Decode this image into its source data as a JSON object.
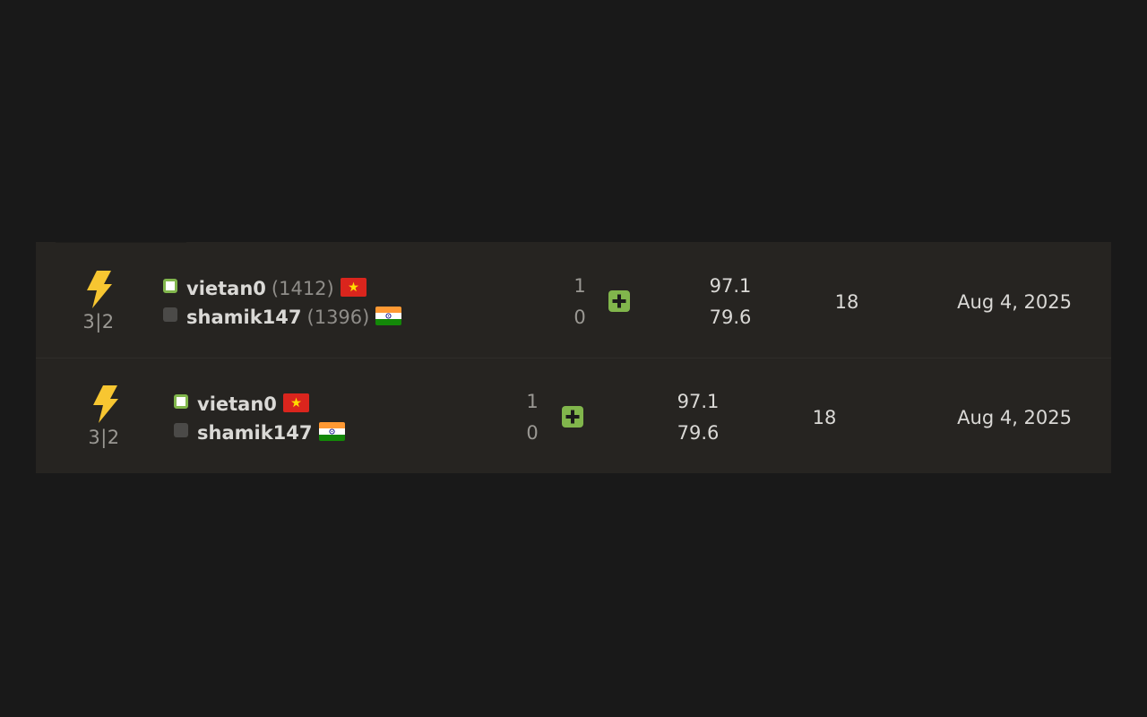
{
  "games": [
    {
      "time_control": "3|2",
      "game_type_icon": "bolt-icon",
      "white": {
        "username": "vietan0",
        "rating": "(1412)",
        "flag": "vietnam-flag-icon"
      },
      "black": {
        "username": "shamik147",
        "rating": "(1396)",
        "flag": "india-flag-icon"
      },
      "result_white": "1",
      "result_black": "0",
      "result_icon": "plus-icon",
      "accuracy_white": "97.1",
      "accuracy_black": "79.6",
      "moves": "18",
      "date": "Aug 4, 2025"
    },
    {
      "time_control": "3|2",
      "game_type_icon": "bolt-icon",
      "white": {
        "username": "vietan0",
        "flag": "vietnam-flag-icon"
      },
      "black": {
        "username": "shamik147",
        "flag": "india-flag-icon"
      },
      "result_white": "1",
      "result_black": "0",
      "result_icon": "plus-icon",
      "accuracy_white": "97.1",
      "accuracy_black": "79.6",
      "moves": "18",
      "date": "Aug 4, 2025"
    }
  ],
  "colors": {
    "background": "#191919",
    "row_background": "#262421",
    "win_green": "#81b64c",
    "bolt_yellow": "#f7c631"
  }
}
